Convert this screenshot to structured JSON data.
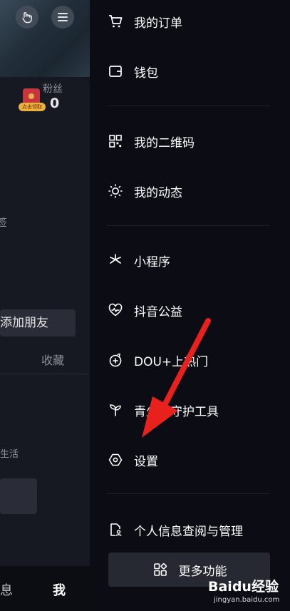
{
  "profile": {
    "fans_label": "粉丝",
    "fans_count": "0",
    "redpacket_tag": "点击领取",
    "side_char": "签",
    "add_friend_label": "添加朋友",
    "collect_label": "收藏",
    "life_text": "生活",
    "nav_message": "息",
    "nav_me": "我"
  },
  "drawer": {
    "items": [
      {
        "icon": "cart-icon",
        "label": "我的订单"
      },
      {
        "icon": "wallet-icon",
        "label": "钱包"
      },
      {
        "icon": "qr-code-icon",
        "label": "我的二维码"
      },
      {
        "icon": "activity-sun-icon",
        "label": "我的动态"
      },
      {
        "icon": "mini-program-icon",
        "label": "小程序"
      },
      {
        "icon": "heart-pulse-icon",
        "label": "抖音公益"
      },
      {
        "icon": "dou-plus-icon",
        "label": "DOU+上热门"
      },
      {
        "icon": "sprout-icon",
        "label": "青少年守护工具"
      },
      {
        "icon": "settings-hexagon-icon",
        "label": "设置"
      },
      {
        "icon": "personal-info-icon",
        "label": "个人信息查阅与管理"
      }
    ],
    "more_label": "更多功能",
    "more_icon": "grid-icon"
  },
  "watermark": {
    "brand": "Baidu经验",
    "url": "jingyan.baidu.com"
  },
  "annotation": {
    "arrow_color": "#e8211d"
  }
}
